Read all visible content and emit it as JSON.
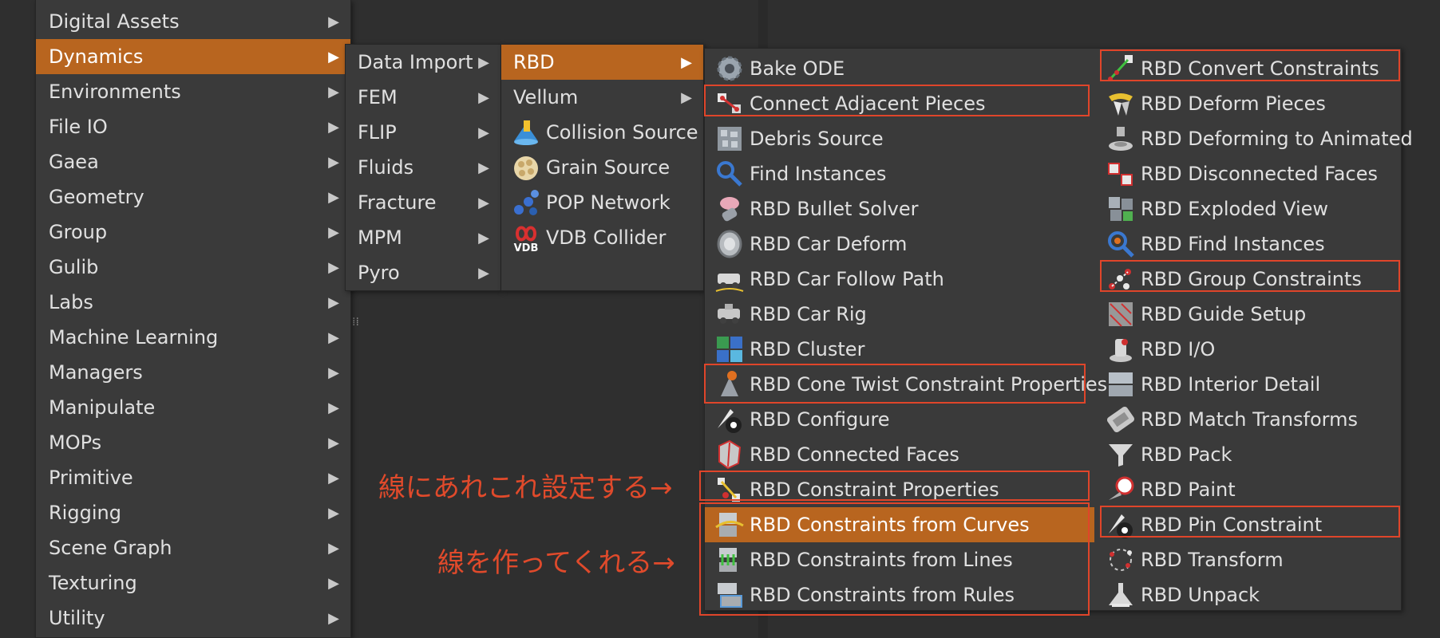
{
  "main_menu": {
    "items": [
      {
        "label": "Digital Assets",
        "has_submenu": true
      },
      {
        "label": "Dynamics",
        "has_submenu": true,
        "selected": true
      },
      {
        "label": "Environments",
        "has_submenu": true
      },
      {
        "label": "File IO",
        "has_submenu": true
      },
      {
        "label": "Gaea",
        "has_submenu": true
      },
      {
        "label": "Geometry",
        "has_submenu": true
      },
      {
        "label": "Group",
        "has_submenu": true
      },
      {
        "label": "Gulib",
        "has_submenu": true
      },
      {
        "label": "Labs",
        "has_submenu": true
      },
      {
        "label": "Machine Learning",
        "has_submenu": true
      },
      {
        "label": "Managers",
        "has_submenu": true
      },
      {
        "label": "Manipulate",
        "has_submenu": true
      },
      {
        "label": "MOPs",
        "has_submenu": true
      },
      {
        "label": "Primitive",
        "has_submenu": true
      },
      {
        "label": "Rigging",
        "has_submenu": true
      },
      {
        "label": "Scene Graph",
        "has_submenu": true
      },
      {
        "label": "Texturing",
        "has_submenu": true
      },
      {
        "label": "Utility",
        "has_submenu": true
      }
    ]
  },
  "dynamics_menu": {
    "items": [
      {
        "label": "Data Import"
      },
      {
        "label": "FEM"
      },
      {
        "label": "FLIP"
      },
      {
        "label": "Fluids"
      },
      {
        "label": "Fracture"
      },
      {
        "label": "MPM"
      },
      {
        "label": "Pyro"
      }
    ]
  },
  "sub_menu": {
    "items": [
      {
        "label": "RBD",
        "submenu": true,
        "selected": true
      },
      {
        "label": "Vellum",
        "submenu": true
      },
      {
        "label": "Collision Source",
        "icon": "collision-source-icon"
      },
      {
        "label": "Grain Source",
        "icon": "grain-source-icon"
      },
      {
        "label": "POP Network",
        "icon": "pop-network-icon"
      },
      {
        "label": "VDB Collider",
        "icon": "vdb-collider-icon"
      }
    ]
  },
  "rbd_menu": {
    "left": [
      {
        "label": "Bake ODE",
        "icon": "gear-icon"
      },
      {
        "label": "Connect Adjacent Pieces",
        "icon": "connect-pieces-icon"
      },
      {
        "label": "Debris Source",
        "icon": "debris-icon"
      },
      {
        "label": "Find Instances",
        "icon": "magnifier-icon"
      },
      {
        "label": "RBD Bullet Solver",
        "icon": "bullet-solver-icon"
      },
      {
        "label": "RBD Car Deform",
        "icon": "tire-icon"
      },
      {
        "label": "RBD Car Follow Path",
        "icon": "car-path-icon"
      },
      {
        "label": "RBD Car Rig",
        "icon": "car-rig-icon"
      },
      {
        "label": "RBD Cluster",
        "icon": "cluster-icon"
      },
      {
        "label": "RBD Cone Twist Constraint Properties",
        "icon": "cone-twist-icon"
      },
      {
        "label": "RBD Configure",
        "icon": "configure-icon"
      },
      {
        "label": "RBD Connected Faces",
        "icon": "connected-faces-icon"
      },
      {
        "label": "RBD Constraint Properties",
        "icon": "constraint-props-icon"
      },
      {
        "label": "RBD Constraints from Curves",
        "icon": "constraints-curves-icon",
        "selected": true
      },
      {
        "label": "RBD Constraints from Lines",
        "icon": "constraints-lines-icon"
      },
      {
        "label": "RBD Constraints from Rules",
        "icon": "constraints-rules-icon"
      }
    ],
    "right": [
      {
        "label": "RBD Convert Constraints",
        "icon": "convert-constraints-icon"
      },
      {
        "label": "RBD Deform Pieces",
        "icon": "deform-pieces-icon"
      },
      {
        "label": "RBD Deforming to Animated",
        "icon": "deforming-animated-icon"
      },
      {
        "label": "RBD Disconnected Faces",
        "icon": "disconnected-faces-icon"
      },
      {
        "label": "RBD Exploded View",
        "icon": "exploded-view-icon"
      },
      {
        "label": "RBD Find Instances",
        "icon": "find-instances-icon"
      },
      {
        "label": "RBD Group Constraints",
        "icon": "group-constraints-icon"
      },
      {
        "label": "RBD Guide Setup",
        "icon": "guide-setup-icon"
      },
      {
        "label": "RBD I/O",
        "icon": "io-icon"
      },
      {
        "label": "RBD Interior Detail",
        "icon": "interior-detail-icon"
      },
      {
        "label": "RBD Match Transforms",
        "icon": "match-transforms-icon"
      },
      {
        "label": "RBD Pack",
        "icon": "pack-icon"
      },
      {
        "label": "RBD Paint",
        "icon": "paint-icon"
      },
      {
        "label": "RBD Pin Constraint",
        "icon": "pin-constraint-icon"
      },
      {
        "label": "RBD Transform",
        "icon": "transform-icon"
      },
      {
        "label": "RBD Unpack",
        "icon": "unpack-icon"
      }
    ]
  },
  "annotations": {
    "note1": "線にあれこれ設定する→",
    "note2": "線を作ってくれる→"
  },
  "colors": {
    "selected": "#b8651f",
    "highlight": "#e0452a",
    "note": "#e04a2b",
    "menu_bg": "#3a3a3a"
  }
}
